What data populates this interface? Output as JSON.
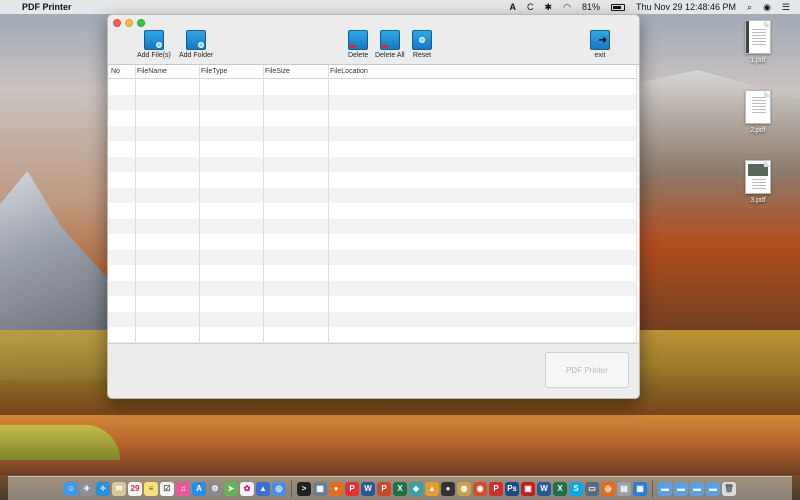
{
  "menubar": {
    "app_name": "PDF Printer",
    "battery": "81%",
    "input_source": "C",
    "clock": "Thu Nov 29  12:48:46 PM"
  },
  "toolbar": {
    "add_files": "Add File(s)",
    "add_folder": "Add Folder",
    "delete": "Delete",
    "delete_all": "Delete All",
    "reset": "Reset",
    "exit": "exit"
  },
  "table": {
    "columns": [
      "No",
      "FileName",
      "FileType",
      "FileSize",
      "FileLocation"
    ],
    "rows": []
  },
  "footer": {
    "pdf_printer_button": "PDF Printer"
  },
  "desktop": {
    "files": [
      "1.pdf",
      "2.pdf",
      "3.pdf"
    ]
  },
  "dock": {
    "apps": [
      "finder",
      "launchpad",
      "safari",
      "mail",
      "calendar",
      "notes",
      "reminders",
      "itunes",
      "app-store",
      "preferences",
      "maps",
      "photos",
      "keynote",
      "chrome",
      "terminal",
      "word",
      "excel",
      "powerpoint",
      "firefox",
      "skype",
      "trash"
    ]
  },
  "colors": {
    "accent": "#1e88d8",
    "close": "#fc605c",
    "minimize": "#fdbc40",
    "maximize": "#34c84a"
  }
}
